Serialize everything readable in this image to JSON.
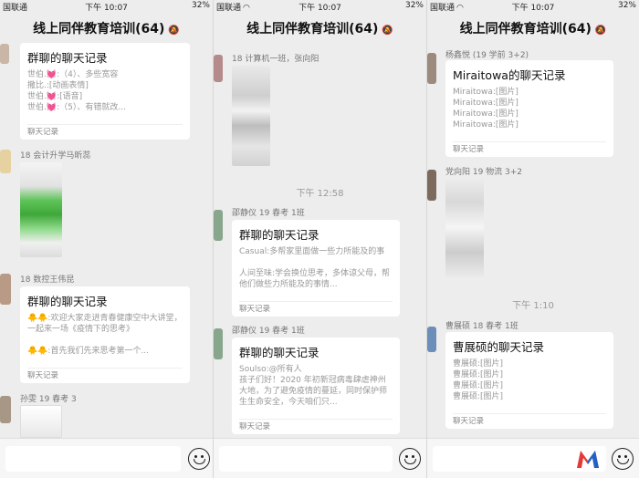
{
  "status_bar": [
    {
      "carrier": "国联通",
      "time": "下午 10:07",
      "battery": "32%"
    },
    {
      "carrier": "国联通",
      "time": "下午 10:07",
      "battery": "32%"
    },
    {
      "carrier": "国联通",
      "time": "下午 10:07",
      "battery": "32%"
    }
  ],
  "chat_title": "线上同伴教育培训(64)",
  "mute_icon": "bell-off-icon",
  "panel1": {
    "card1": {
      "title": "群聊的聊天记录",
      "lines": [
        "世伯.💓:（4）、多些宽容",
        "撒比.:[动画表情]",
        "世伯.💓:[语音]",
        "世伯.💓:（5）、有错就改..."
      ],
      "footer": "聊天记录"
    },
    "sender2": "18 会计升学马昕蕊",
    "sender3": "18 数控王伟昆",
    "card3": {
      "title": "群聊的聊天记录",
      "lines": [
        "🐥🐥:欢迎大家走进青春健康空中大讲堂，一起来一场《疫情下的思考》",
        "🐥🐥:首先我们先来思考第一个..."
      ],
      "footer": "聊天记录"
    },
    "sender4": "孙雯 19 春考 3"
  },
  "panel2": {
    "sender1": "18 计算机一班，张向阳",
    "timestamp": "下午 12:58",
    "sender2": "邵静仪 19 春考 1班",
    "card2": {
      "title": "群聊的聊天记录",
      "lines": [
        "Casual:多帮家里面做一些力所能及的事",
        "人间至味:学会换位思考，多体谅父母，帮他们做些力所能及的事情..."
      ],
      "footer": "聊天记录"
    },
    "sender3": "邵静仪 19 春考 1班",
    "card3": {
      "title": "群聊的聊天记录",
      "lines": [
        "Soulso:@所有人",
        "孩子们好！2020 年初新冠病毒肆虐神州大地，为了避免疫情的蔓延，同时保护师生生命安全，今天咱们只..."
      ],
      "footer": "聊天记录"
    }
  },
  "panel3": {
    "sender1": "杨鑫悦 (19 学前 3+2)",
    "card1": {
      "title": "Miraitowa的聊天记录",
      "lines": [
        "Miraitowa:[图片]",
        "Miraitowa:[图片]",
        "Miraitowa:[图片]",
        "Miraitowa:[图片]"
      ],
      "footer": "聊天记录"
    },
    "sender2": "党向阳 19 物流 3+2",
    "timestamp": "下午 1:10",
    "sender3": "曹展硕 18 春考 1班",
    "card3": {
      "title": "曹展硕的聊天记录",
      "lines": [
        "曹展硕:[图片]",
        "曹展硕:[图片]",
        "曹展硕:[图片]",
        "曹展硕:[图片]"
      ],
      "footer": "聊天记录"
    }
  },
  "input_bar": {
    "emoji_icon": "smiley-face-icon"
  },
  "colors": {
    "background": "#ededed",
    "card": "#ffffff",
    "heart": "#e2337f",
    "logo_red": "#e53935",
    "logo_blue": "#1e63c8"
  }
}
